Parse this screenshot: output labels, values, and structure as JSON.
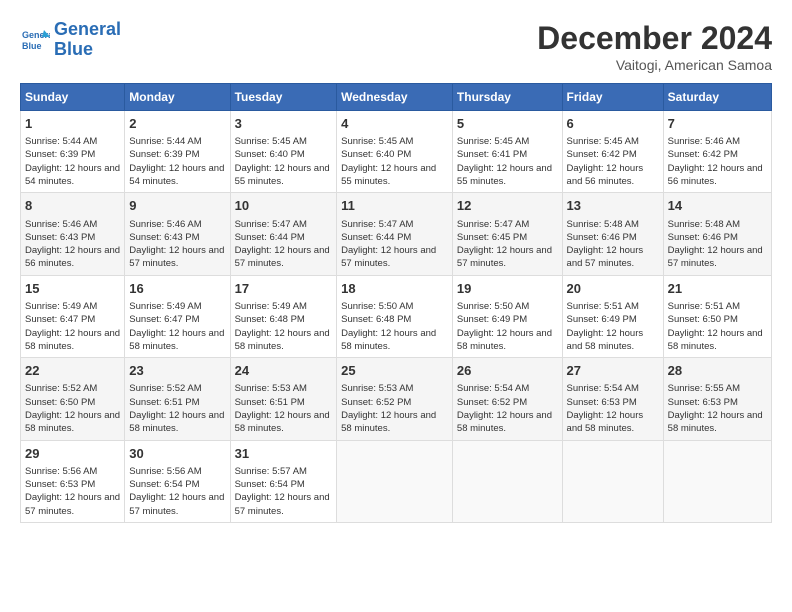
{
  "header": {
    "logo_line1": "General",
    "logo_line2": "Blue",
    "title": "December 2024",
    "subtitle": "Vaitogi, American Samoa"
  },
  "days_of_week": [
    "Sunday",
    "Monday",
    "Tuesday",
    "Wednesday",
    "Thursday",
    "Friday",
    "Saturday"
  ],
  "weeks": [
    [
      {
        "day": "1",
        "sunrise": "5:44 AM",
        "sunset": "6:39 PM",
        "daylight": "12 hours and 54 minutes."
      },
      {
        "day": "2",
        "sunrise": "5:44 AM",
        "sunset": "6:39 PM",
        "daylight": "12 hours and 54 minutes."
      },
      {
        "day": "3",
        "sunrise": "5:45 AM",
        "sunset": "6:40 PM",
        "daylight": "12 hours and 55 minutes."
      },
      {
        "day": "4",
        "sunrise": "5:45 AM",
        "sunset": "6:40 PM",
        "daylight": "12 hours and 55 minutes."
      },
      {
        "day": "5",
        "sunrise": "5:45 AM",
        "sunset": "6:41 PM",
        "daylight": "12 hours and 55 minutes."
      },
      {
        "day": "6",
        "sunrise": "5:45 AM",
        "sunset": "6:42 PM",
        "daylight": "12 hours and 56 minutes."
      },
      {
        "day": "7",
        "sunrise": "5:46 AM",
        "sunset": "6:42 PM",
        "daylight": "12 hours and 56 minutes."
      }
    ],
    [
      {
        "day": "8",
        "sunrise": "5:46 AM",
        "sunset": "6:43 PM",
        "daylight": "12 hours and 56 minutes."
      },
      {
        "day": "9",
        "sunrise": "5:46 AM",
        "sunset": "6:43 PM",
        "daylight": "12 hours and 57 minutes."
      },
      {
        "day": "10",
        "sunrise": "5:47 AM",
        "sunset": "6:44 PM",
        "daylight": "12 hours and 57 minutes."
      },
      {
        "day": "11",
        "sunrise": "5:47 AM",
        "sunset": "6:44 PM",
        "daylight": "12 hours and 57 minutes."
      },
      {
        "day": "12",
        "sunrise": "5:47 AM",
        "sunset": "6:45 PM",
        "daylight": "12 hours and 57 minutes."
      },
      {
        "day": "13",
        "sunrise": "5:48 AM",
        "sunset": "6:46 PM",
        "daylight": "12 hours and 57 minutes."
      },
      {
        "day": "14",
        "sunrise": "5:48 AM",
        "sunset": "6:46 PM",
        "daylight": "12 hours and 57 minutes."
      }
    ],
    [
      {
        "day": "15",
        "sunrise": "5:49 AM",
        "sunset": "6:47 PM",
        "daylight": "12 hours and 58 minutes."
      },
      {
        "day": "16",
        "sunrise": "5:49 AM",
        "sunset": "6:47 PM",
        "daylight": "12 hours and 58 minutes."
      },
      {
        "day": "17",
        "sunrise": "5:49 AM",
        "sunset": "6:48 PM",
        "daylight": "12 hours and 58 minutes."
      },
      {
        "day": "18",
        "sunrise": "5:50 AM",
        "sunset": "6:48 PM",
        "daylight": "12 hours and 58 minutes."
      },
      {
        "day": "19",
        "sunrise": "5:50 AM",
        "sunset": "6:49 PM",
        "daylight": "12 hours and 58 minutes."
      },
      {
        "day": "20",
        "sunrise": "5:51 AM",
        "sunset": "6:49 PM",
        "daylight": "12 hours and 58 minutes."
      },
      {
        "day": "21",
        "sunrise": "5:51 AM",
        "sunset": "6:50 PM",
        "daylight": "12 hours and 58 minutes."
      }
    ],
    [
      {
        "day": "22",
        "sunrise": "5:52 AM",
        "sunset": "6:50 PM",
        "daylight": "12 hours and 58 minutes."
      },
      {
        "day": "23",
        "sunrise": "5:52 AM",
        "sunset": "6:51 PM",
        "daylight": "12 hours and 58 minutes."
      },
      {
        "day": "24",
        "sunrise": "5:53 AM",
        "sunset": "6:51 PM",
        "daylight": "12 hours and 58 minutes."
      },
      {
        "day": "25",
        "sunrise": "5:53 AM",
        "sunset": "6:52 PM",
        "daylight": "12 hours and 58 minutes."
      },
      {
        "day": "26",
        "sunrise": "5:54 AM",
        "sunset": "6:52 PM",
        "daylight": "12 hours and 58 minutes."
      },
      {
        "day": "27",
        "sunrise": "5:54 AM",
        "sunset": "6:53 PM",
        "daylight": "12 hours and 58 minutes."
      },
      {
        "day": "28",
        "sunrise": "5:55 AM",
        "sunset": "6:53 PM",
        "daylight": "12 hours and 58 minutes."
      }
    ],
    [
      {
        "day": "29",
        "sunrise": "5:56 AM",
        "sunset": "6:53 PM",
        "daylight": "12 hours and 57 minutes."
      },
      {
        "day": "30",
        "sunrise": "5:56 AM",
        "sunset": "6:54 PM",
        "daylight": "12 hours and 57 minutes."
      },
      {
        "day": "31",
        "sunrise": "5:57 AM",
        "sunset": "6:54 PM",
        "daylight": "12 hours and 57 minutes."
      },
      null,
      null,
      null,
      null
    ]
  ]
}
